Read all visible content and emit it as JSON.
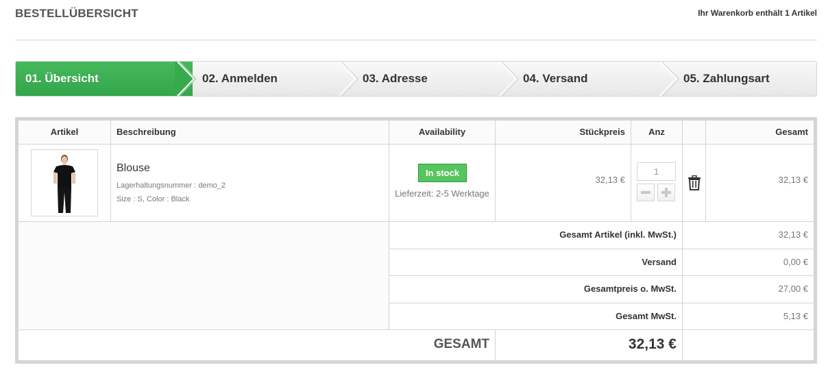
{
  "header": {
    "title": "Bestellübersicht",
    "cart_summary": "Ihr Warenkorb enthält 1 Artikel"
  },
  "steps": [
    {
      "label": "01. Übersicht",
      "active": true
    },
    {
      "label": "02. Anmelden",
      "active": false
    },
    {
      "label": "03. Adresse",
      "active": false
    },
    {
      "label": "04. Versand",
      "active": false
    },
    {
      "label": "05. Zahlungsart",
      "active": false
    }
  ],
  "table": {
    "headers": {
      "artikel": "Artikel",
      "beschreibung": "Beschreibung",
      "availability": "Availability",
      "stueckpreis": "Stückpreis",
      "anz": "Anz",
      "gesamt": "Gesamt"
    },
    "item": {
      "name": "Blouse",
      "reference": "Lagerhaltungsnummer : demo_2",
      "attributes": "Size : S, Color : Black",
      "stock_status": "In stock",
      "delivery_time": "Lieferzeit: 2-5 Werktage",
      "unit_price": "32,13 €",
      "quantity": "1",
      "total": "32,13 €"
    },
    "summary": [
      {
        "label": "Gesamt Artikel (inkl. MwSt.)",
        "value": "32,13 €"
      },
      {
        "label": "Versand",
        "value": "0,00 €"
      },
      {
        "label": "Gesamtpreis o. MwSt.",
        "value": "27,00 €"
      },
      {
        "label": "Gesamt MwSt.",
        "value": "5,13 €"
      }
    ],
    "grand_total": {
      "label": "GESAMT",
      "value": "32,13 €"
    }
  },
  "colors": {
    "active_step": "#3aaf4f",
    "stock_badge": "#55c65e",
    "border": "#d6d4d4"
  }
}
